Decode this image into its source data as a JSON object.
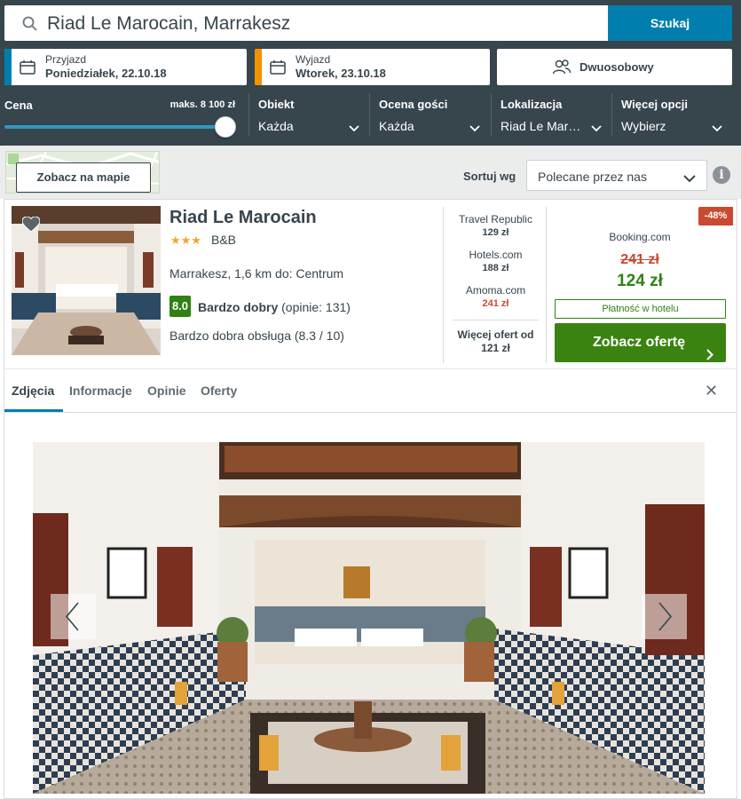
{
  "search": {
    "query": "Riad Le Marocain, Marrakesz",
    "button": "Szukaj"
  },
  "dates": {
    "checkin": {
      "label": "Przyjazd",
      "value": "Poniedziałek, 22.10.18",
      "color": "#007faf"
    },
    "checkout": {
      "label": "Wyjazd",
      "value": "Wtorek, 23.10.18",
      "color": "#f39200"
    }
  },
  "guests": {
    "value": "Dwuosobowy"
  },
  "filters": {
    "price": {
      "label": "Cena",
      "max_label": "maks. 8 100 zł",
      "slider_fraction": 1.0
    },
    "columns": [
      {
        "label": "Obiekt",
        "value": "Każda"
      },
      {
        "label": "Ocena gości",
        "value": "Każda"
      },
      {
        "label": "Lokalizacja",
        "value": "Riad Le Mar…"
      },
      {
        "label": "Więcej opcji",
        "value": "Wybierz"
      }
    ]
  },
  "sortbar": {
    "map_button": "Zobacz na mapie",
    "sort_label": "Sortuj wg",
    "sort_value": "Polecane przez nas"
  },
  "hotel": {
    "name": "Riad Le Marocain",
    "stars": "★★★",
    "type": "B&B",
    "location": "Marrakesz, 1,6 km do: Centrum",
    "score": "8.0",
    "rating_text": "Bardzo dobry",
    "reviews": "(opinie: 131)",
    "service": "Bardzo dobra obsługa (8.3 / 10)"
  },
  "offers": [
    {
      "provider": "Travel Republic",
      "price": "129 zł",
      "highlight": false
    },
    {
      "provider": "Hotels.com",
      "price": "188 zł",
      "highlight": false
    },
    {
      "provider": "Amoma.com",
      "price": "241 zł",
      "highlight": true
    }
  ],
  "more_offers": {
    "line1": "Więcej ofert od",
    "line2": "121 zł"
  },
  "best_offer": {
    "discount": "-48%",
    "site": "Booking.com",
    "old_price": "241 zł",
    "price": "124 zł",
    "payment": "Płatność w hotelu",
    "cta": "Zobacz ofertę"
  },
  "tabs": [
    "Zdjęcia",
    "Informacje",
    "Opinie",
    "Oferty"
  ],
  "colors": {
    "header": "#37454d",
    "accent": "#007faf",
    "green": "#2f8114",
    "red": "#c94a30"
  }
}
